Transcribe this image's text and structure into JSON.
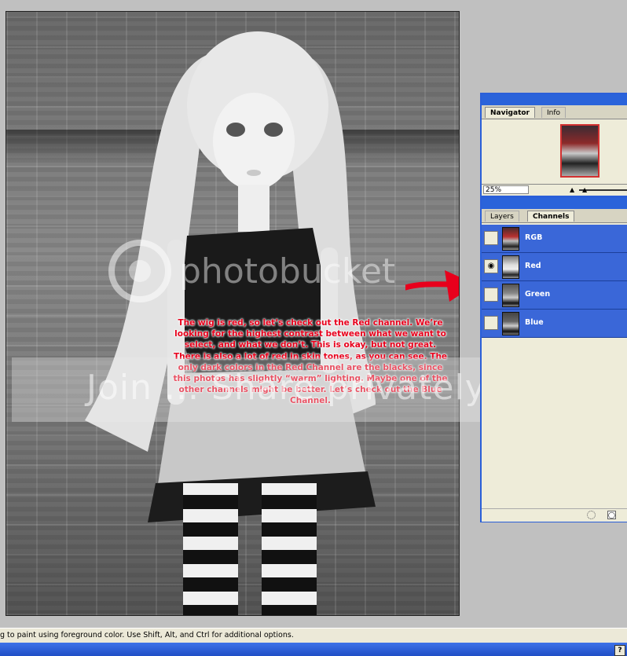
{
  "canvas": {
    "watermark_text": "Join ... Share privately.",
    "watermark_logo": "photobucket",
    "annotation": "The wig is red, so let’s check out the Red channel.  We’re looking for the highest contrast between what we want to select, and what we don’t.  This is okay, but not great.  There is also a lot of red in skin tones, as you can see.  The only dark colors in the Red Channel are the blacks, since this photos has slightly “warm” lighting.  Maybe one of the other channels might be better.  Let’s check out the Blue Channel.",
    "arrow_color": "#e8001c"
  },
  "navigator": {
    "tabs": [
      {
        "label": "Navigator",
        "active": true
      },
      {
        "label": "Info",
        "active": false
      }
    ],
    "zoom": "25%"
  },
  "channels_palette": {
    "tabs": [
      {
        "label": "Layers",
        "active": false
      },
      {
        "label": "Channels",
        "active": true
      }
    ],
    "rows": [
      {
        "label": "RGB",
        "visible": false,
        "selected": true
      },
      {
        "label": "Red",
        "visible": true,
        "selected": true
      },
      {
        "label": "Green",
        "visible": false,
        "selected": true
      },
      {
        "label": "Blue",
        "visible": false,
        "selected": true
      }
    ],
    "highlight_color": "#3a67d8"
  },
  "status_bar": {
    "text": "g to paint using foreground color.  Use Shift, Alt, and Ctrl for additional options."
  },
  "help_button": "?"
}
